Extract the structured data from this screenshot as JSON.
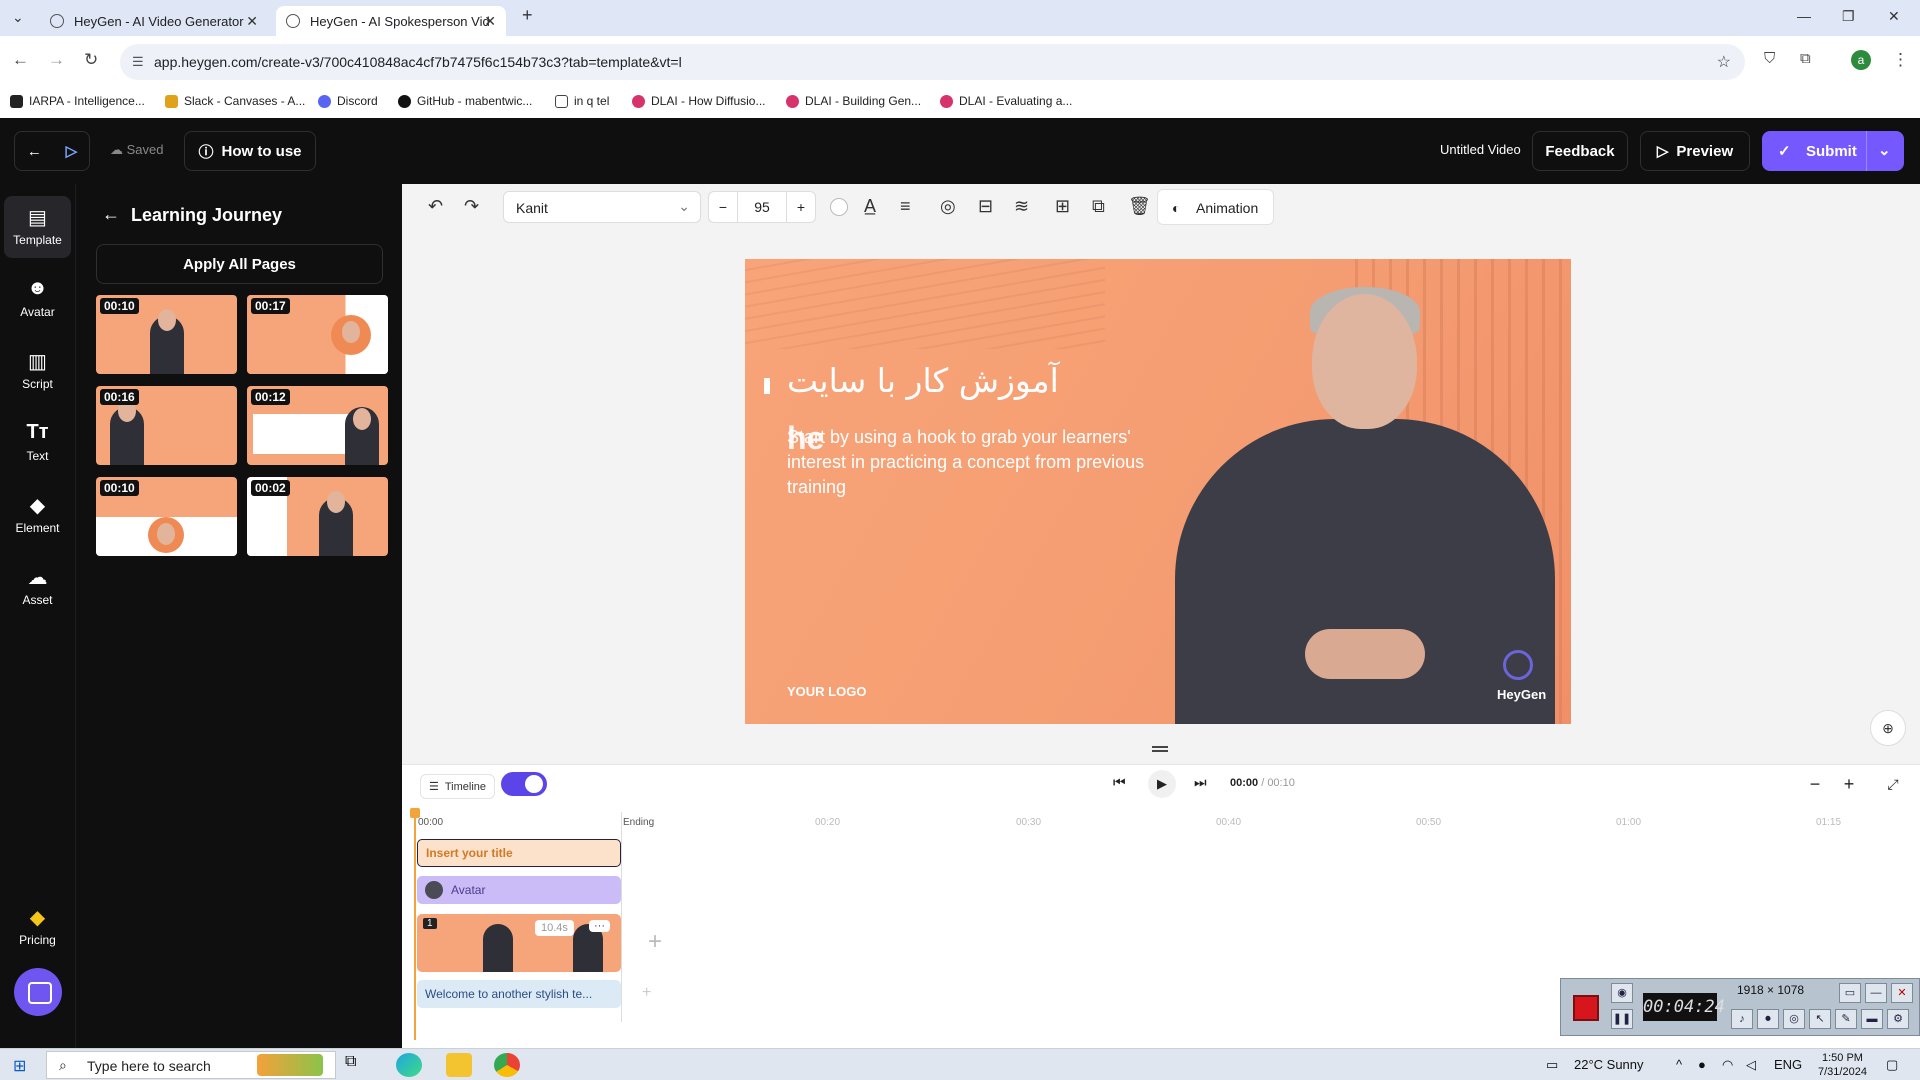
{
  "browser": {
    "tabs": [
      {
        "label": "HeyGen - AI Video Generator",
        "active": false
      },
      {
        "label": "HeyGen - AI Spokesperson Vid",
        "active": true
      }
    ],
    "url": "app.heygen.com/create-v3/700c410848ac4cf7b7475f6c154b73c3?tab=template&vt=l",
    "bookmarks": [
      "IARPA - Intelligence...",
      "Slack - Canvases - A...",
      "Discord",
      "GitHub - mabentwic...",
      "in q tel",
      "DLAI - How Diffusio...",
      "DLAI - Building Gen...",
      "DLAI - Evaluating a..."
    ],
    "profile_initial": "a"
  },
  "header": {
    "saved_label": "Saved",
    "how_to_use_label": "How to use",
    "video_title": "Untitled Video",
    "feedback_label": "Feedback",
    "preview_label": "Preview",
    "submit_label": "Submit"
  },
  "rail": {
    "items": [
      {
        "label": "Template",
        "icon": "template-icon"
      },
      {
        "label": "Avatar",
        "icon": "avatar-icon"
      },
      {
        "label": "Script",
        "icon": "script-icon"
      },
      {
        "label": "Text",
        "icon": "text-icon"
      },
      {
        "label": "Element",
        "icon": "element-icon"
      },
      {
        "label": "Asset",
        "icon": "upload-icon"
      }
    ],
    "pricing_label": "Pricing"
  },
  "panel": {
    "title": "Learning Journey",
    "apply_label": "Apply All Pages",
    "thumbnails": [
      {
        "duration": "00:10"
      },
      {
        "duration": "00:17"
      },
      {
        "duration": "00:16"
      },
      {
        "duration": "00:12"
      },
      {
        "duration": "00:10"
      },
      {
        "duration": "00:02"
      }
    ]
  },
  "toolbar": {
    "font": "Kanit",
    "font_size": "95",
    "animation_label": "Animation"
  },
  "canvas": {
    "title_text": "آموزش کار با سایت",
    "ghost_text": "he",
    "body_text": "Start by using a hook to grab your learners' interest in practicing a concept from previous training",
    "logo_text": "YOUR LOGO",
    "brand_text": "HeyGen",
    "background_color": "#f6a57a"
  },
  "timeline": {
    "label": "Timeline",
    "current_time": "00:00",
    "total_time": "/ 00:10",
    "ruler": [
      "00:00",
      "Ending",
      "00:20",
      "00:30",
      "00:40",
      "00:50",
      "01:00",
      "01:15"
    ],
    "tracks": {
      "title": "Insert your title",
      "avatar": "Avatar",
      "scene_number": "1",
      "scene_duration": "10.4s",
      "scene_more": "···",
      "text": "Welcome to another stylish te..."
    }
  },
  "recorder": {
    "time": "00:04:24",
    "resolution": "1918 × 1078"
  },
  "taskbar": {
    "search_placeholder": "Type here to search",
    "weather": "22°C  Sunny",
    "language": "ENG",
    "time": "1:50 PM",
    "date": "7/31/2024"
  }
}
